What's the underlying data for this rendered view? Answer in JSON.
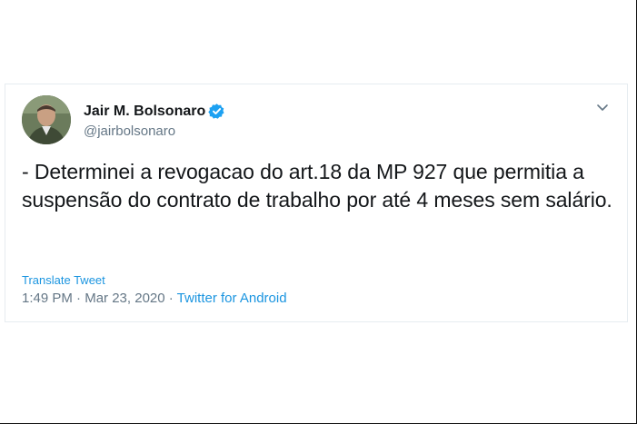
{
  "tweet": {
    "author": {
      "display_name": "Jair M. Bolsonaro",
      "handle": "@jairbolsonaro",
      "verified": true
    },
    "text": "- Determinei a revogacao do art.18 da MP 927 que permitia a suspensão do contrato de trabalho por até 4 meses sem salário.",
    "translate_label": "Translate Tweet",
    "time": "1:49 PM",
    "separator": " · ",
    "date": "Mar 23, 2020",
    "source": "Twitter for Android"
  },
  "icons": {
    "verified": "verified-badge-icon",
    "menu": "chevron-down-icon"
  },
  "colors": {
    "link": "#1b95e0",
    "muted": "#657786",
    "text": "#14171a",
    "border": "#e6ecf0"
  }
}
